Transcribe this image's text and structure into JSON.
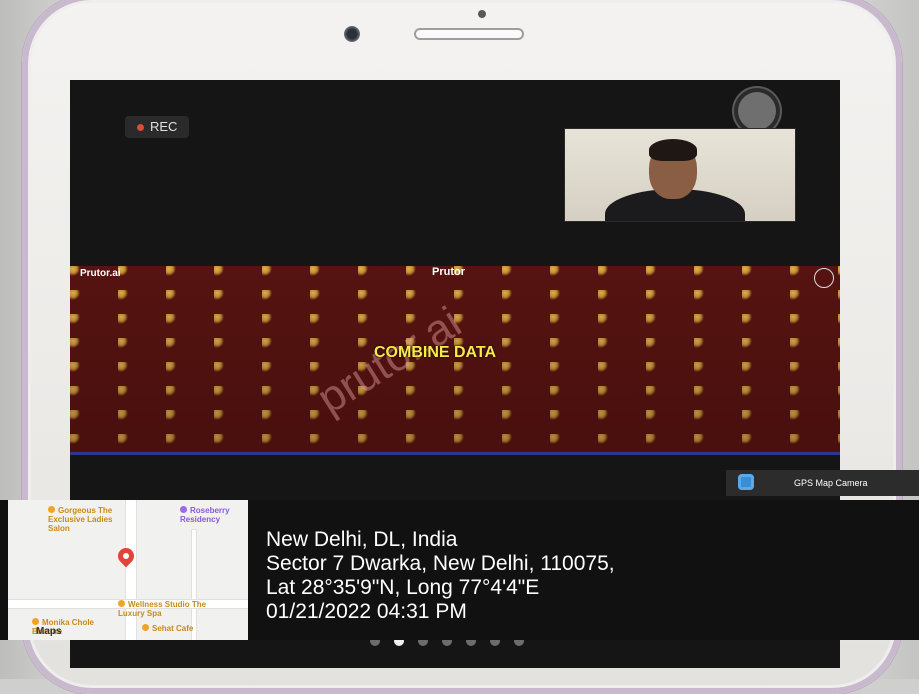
{
  "zoom_call": {
    "recording_label": "REC",
    "shared_screen": {
      "brand": "Prutor.ai",
      "title": "Prutor",
      "watermark": "prutor.ai",
      "heading": "COMBINE DATA"
    }
  },
  "gps_overlay": {
    "app_name": "GPS Map Camera",
    "location_line": "New Delhi, DL, India",
    "address_line": "Sector 7 Dwarka, New Delhi, 110075,",
    "coords_line": "Lat 28°35'9\"N, Long 77°4'4\"E",
    "datetime_line": "01/21/2022 04:31 PM",
    "map": {
      "pois": [
        {
          "label": "Gorgeous The Exclusive Ladies Salon",
          "color": "orange"
        },
        {
          "label": "Roseberry Residency",
          "color": "purple"
        },
        {
          "label": "Wellness Studio The Luxury Spa",
          "color": "orange"
        },
        {
          "label": "Monika Chole Bhature",
          "color": "orange"
        },
        {
          "label": "Sehat Cafe",
          "color": "orange"
        }
      ],
      "attribution": "Maps"
    }
  },
  "page_indicator": {
    "count": 7,
    "active_index": 1
  },
  "colors": {
    "accent_yellow": "#f5ec4a",
    "rec_red": "#e04a3a",
    "share_bg": "#5a1512"
  }
}
